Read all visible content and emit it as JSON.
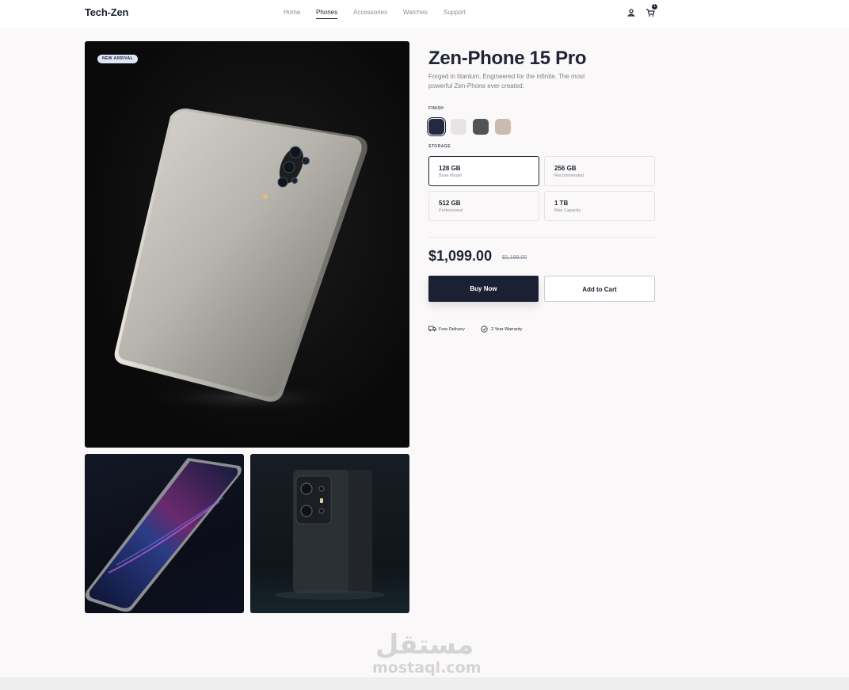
{
  "brand": "Tech-Zen",
  "nav": {
    "links": [
      {
        "label": "Home",
        "active": false
      },
      {
        "label": "Phones",
        "active": true
      },
      {
        "label": "Accessories",
        "active": false
      },
      {
        "label": "Watches",
        "active": false
      },
      {
        "label": "Support",
        "active": false
      }
    ],
    "icons": [
      "user-icon",
      "cart-icon"
    ],
    "cart_count": "1"
  },
  "gallery": {
    "badge": "NEW ARRIVAL"
  },
  "product": {
    "title": "Zen-Phone 15 Pro",
    "subtitle": "Forged in titanium. Engineered for the infinite. The most powerful Zen-Phone ever created.",
    "finish_label": "FINISH",
    "finishes": [
      {
        "color": "#232a40",
        "selected": true
      },
      {
        "color": "#e5e3e5",
        "selected": false
      },
      {
        "color": "#505358",
        "selected": false
      },
      {
        "color": "#c9bcae",
        "selected": false
      }
    ],
    "storage_label": "STORAGE",
    "storage": [
      {
        "size": "128 GB",
        "desc": "Base Model",
        "selected": true
      },
      {
        "size": "256 GB",
        "desc": "Recommended",
        "selected": false
      },
      {
        "size": "512 GB",
        "desc": "Professional",
        "selected": false
      },
      {
        "size": "1 TB",
        "desc": "Max Capacity",
        "selected": false
      }
    ],
    "price": "$1,099.00",
    "old_price": "$1,199.00",
    "buy_label": "Buy Now",
    "cart_label": "Add to Cart",
    "features": [
      {
        "icon": "truck-icon",
        "label": "Free Delivery"
      },
      {
        "icon": "check-circle-icon",
        "label": "2 Year Warranty"
      }
    ]
  },
  "watermark": {
    "arabic": "مستقل",
    "latin": "mostaql.com"
  },
  "colors": {
    "primary": "#1b2033",
    "background": "#fbf8f9"
  }
}
